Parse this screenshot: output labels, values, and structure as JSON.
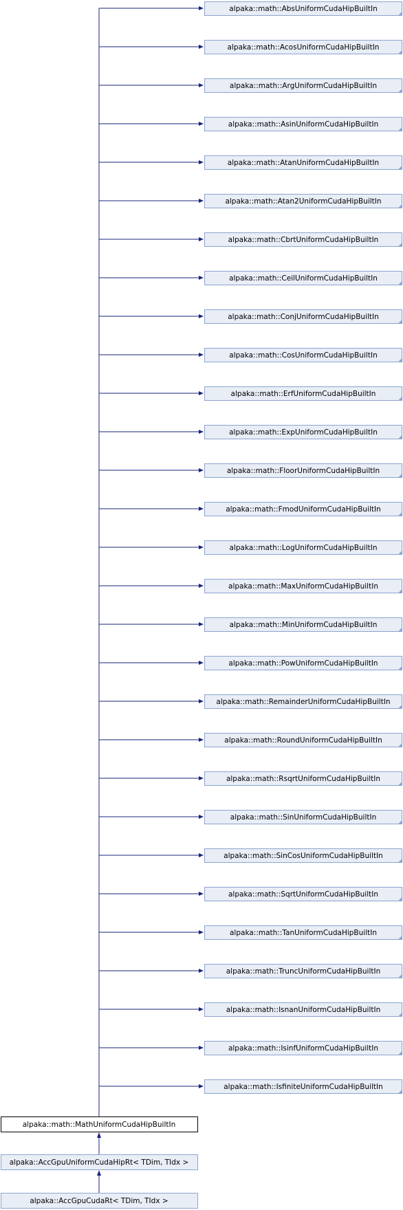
{
  "diagram": {
    "type": "inheritance-graph",
    "base": {
      "label": "alpaka::math::MathUniformCudaHipBuiltIn",
      "parents": [
        "alpaka::math::AbsUniformCudaHipBuiltIn",
        "alpaka::math::AcosUniformCudaHipBuiltIn",
        "alpaka::math::ArgUniformCudaHipBuiltIn",
        "alpaka::math::AsinUniformCudaHipBuiltIn",
        "alpaka::math::AtanUniformCudaHipBuiltIn",
        "alpaka::math::Atan2UniformCudaHipBuiltIn",
        "alpaka::math::CbrtUniformCudaHipBuiltIn",
        "alpaka::math::CeilUniformCudaHipBuiltIn",
        "alpaka::math::ConjUniformCudaHipBuiltIn",
        "alpaka::math::CosUniformCudaHipBuiltIn",
        "alpaka::math::ErfUniformCudaHipBuiltIn",
        "alpaka::math::ExpUniformCudaHipBuiltIn",
        "alpaka::math::FloorUniformCudaHipBuiltIn",
        "alpaka::math::FmodUniformCudaHipBuiltIn",
        "alpaka::math::LogUniformCudaHipBuiltIn",
        "alpaka::math::MaxUniformCudaHipBuiltIn",
        "alpaka::math::MinUniformCudaHipBuiltIn",
        "alpaka::math::PowUniformCudaHipBuiltIn",
        "alpaka::math::RemainderUniformCudaHipBuiltIn",
        "alpaka::math::RoundUniformCudaHipBuiltIn",
        "alpaka::math::RsqrtUniformCudaHipBuiltIn",
        "alpaka::math::SinUniformCudaHipBuiltIn",
        "alpaka::math::SinCosUniformCudaHipBuiltIn",
        "alpaka::math::SqrtUniformCudaHipBuiltIn",
        "alpaka::math::TanUniformCudaHipBuiltIn",
        "alpaka::math::TruncUniformCudaHipBuiltIn",
        "alpaka::math::IsnanUniformCudaHipBuiltIn",
        "alpaka::math::IsinfUniformCudaHipBuiltIn",
        "alpaka::math::IsfiniteUniformCudaHipBuiltIn"
      ]
    },
    "derived": [
      "alpaka::AccGpuUniformCudaHipRt< TDim, TIdx >",
      "alpaka::AccGpuCudaRt< TDim, TIdx >"
    ],
    "colors": {
      "edge": "#1a237e",
      "node_fill": "#e8edf6",
      "node_border": "#8da4cf",
      "main_border": "#000000"
    }
  }
}
